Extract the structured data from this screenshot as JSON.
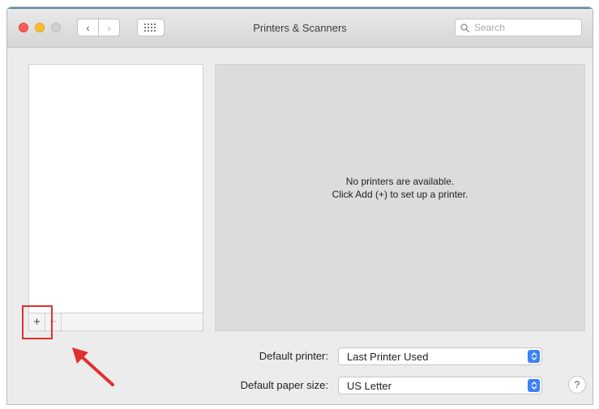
{
  "window": {
    "title": "Printers & Scanners"
  },
  "toolbar": {
    "back_icon": "chevron-left-icon",
    "forward_icon": "chevron-right-icon",
    "show_all_icon": "grid-icon",
    "search_placeholder": "Search",
    "search_value": ""
  },
  "printer_list": {
    "items": [],
    "add_label": "+",
    "remove_label": "−"
  },
  "detail": {
    "empty_line1": "No printers are available.",
    "empty_line2": "Click Add (+) to set up a printer."
  },
  "settings": {
    "default_printer_label": "Default printer:",
    "default_printer_value": "Last Printer Used",
    "paper_size_label": "Default paper size:",
    "paper_size_value": "US Letter",
    "help_label": "?"
  },
  "colors": {
    "annotation": "#e0302e",
    "popup_accent": "#3b82f6"
  }
}
